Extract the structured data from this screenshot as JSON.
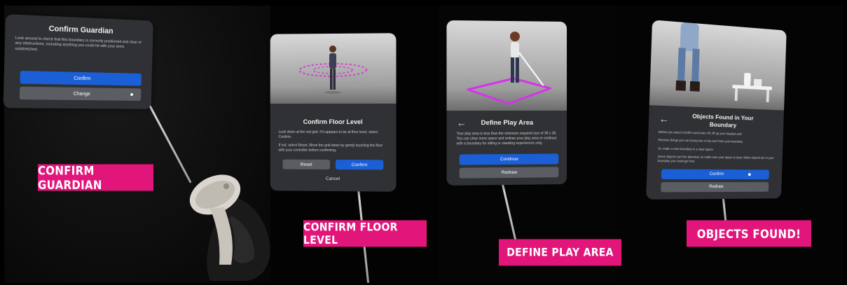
{
  "panel1": {
    "title": "Confirm Guardian",
    "body": "Look around to check that this boundary is correctly positioned and clear of any obstructions, including anything you could hit with your arms outstretched.",
    "confirm_label": "Confirm",
    "change_label": "Change"
  },
  "panel2": {
    "title": "Confirm Floor Level",
    "body1": "Look down at the red grid. If it appears to be at floor level, select Confirm.",
    "body2": "If not, select Reset. Move the grid down by gently touching the floor with your controller before confirming.",
    "reset_label": "Reset",
    "confirm_label": "Confirm",
    "cancel_label": "Cancel"
  },
  "panel3": {
    "title": "Define Play Area",
    "body": "Your play area is less than the minimum required size of 3ft x 3ft. You can clear more space and redraw your play area or continue with a boundary for sitting or standing experiences only.",
    "continue_label": "Continue",
    "redraw_label": "Redraw"
  },
  "panel4": {
    "title": "Objects Found in Your Boundary",
    "intro": "Before you select Confirm and enter VR, lift up your headset and:",
    "bullet1": "Remove things you can bump into or trip over from your boundary",
    "bullet2": "Or, make a new boundary in a clear space.",
    "note": "Some objects can't be detected, so make sure your space is clear. When objects are in your boundary you could get hurt.",
    "confirm_label": "Confirm",
    "redraw_label": "Redraw"
  },
  "captions": {
    "c1": "CONFIRM GUARDIAN",
    "c2": "CONFIRM FLOOR LEVEL",
    "c3": "DEFINE PLAY AREA",
    "c4": "OBJECTS FOUND!"
  },
  "colors": {
    "accent_pink": "#e2157a",
    "button_blue": "#1b5fd6",
    "panel_bg": "#2f3135",
    "boundary_magenta": "#d434e8"
  }
}
